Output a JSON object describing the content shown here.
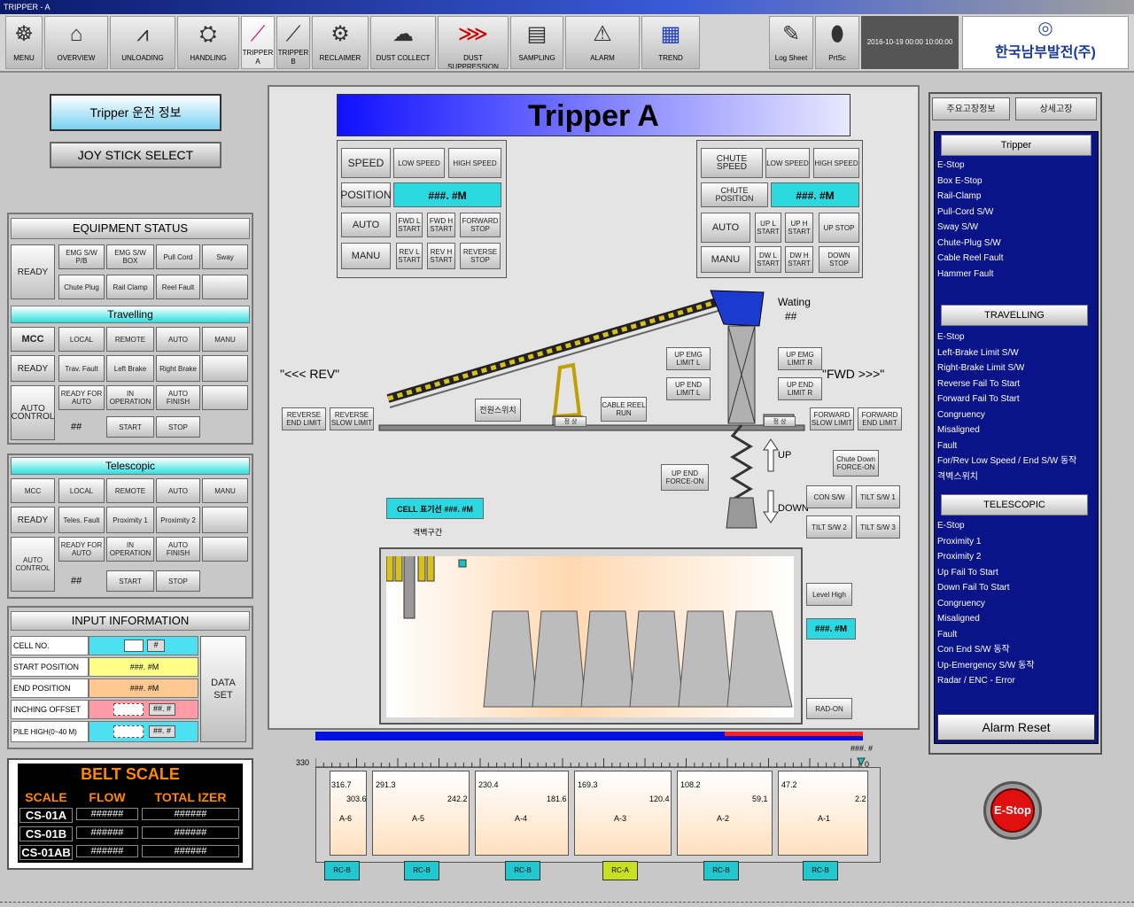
{
  "window": {
    "title": "TRIPPER - A"
  },
  "toolbar": {
    "buttons": [
      "MENU",
      "OVERVIEW",
      "UNLOADING",
      "HANDLING",
      "TRIPPER A",
      "TRIPPER B",
      "RECLAIMER",
      "DUST COLLECT",
      "DUST SUPPRESSION",
      "SAMPLING",
      "ALARM",
      "TREND",
      "Log Sheet",
      "PrtSc"
    ],
    "datetime": "2016-10-19 00:00 10:00:00",
    "logo": "한국남부발전(주)"
  },
  "left": {
    "info_btn": "Tripper 운전 정보",
    "joy_btn": "JOY STICK SELECT"
  },
  "equipment": {
    "title": "EQUIPMENT STATUS",
    "ready": "READY",
    "row1": [
      "EMG S/W P/B",
      "EMG S/W BOX",
      "Pull Cord",
      "Sway"
    ],
    "row2": [
      "Chute Plug",
      "Rail Clamp",
      "Reel Fault"
    ]
  },
  "travelling": {
    "title": "Travelling",
    "mcc": "MCC",
    "modes": [
      "LOCAL",
      "REMOTE",
      "AUTO",
      "MANU"
    ],
    "ready": "READY",
    "faults": [
      "Trav. Fault",
      "Left Brake",
      "Right Brake"
    ],
    "auto_control": "AUTO CONTROL",
    "status": [
      "READY FOR AUTO",
      "IN OPERATION",
      "AUTO FINISH"
    ],
    "hash": "##",
    "start": "START",
    "stop": "STOP"
  },
  "telescopic": {
    "title": "Telescopic",
    "mcc": "MCC",
    "modes": [
      "LOCAL",
      "REMOTE",
      "AUTO",
      "MANU"
    ],
    "ready": "READY",
    "faults": [
      "Teles. Fault",
      "Proximity 1",
      "Proximity 2"
    ],
    "auto_control": "AUTO CONTROL",
    "status": [
      "READY FOR AUTO",
      "IN OPERATION",
      "AUTO FINISH"
    ],
    "hash": "##",
    "start": "START",
    "stop": "STOP"
  },
  "input": {
    "title": "INPUT INFORMATION",
    "rows": [
      {
        "label": "CELL NO.",
        "value": "#"
      },
      {
        "label": "START POSITION",
        "value": "###. #M"
      },
      {
        "label": "END POSITION",
        "value": "###. #M"
      },
      {
        "label": "INCHING OFFSET",
        "value": "##. #"
      },
      {
        "label": "PILE HIGH(0~40 M)",
        "value": "##. #"
      }
    ],
    "data_set": "DATA SET"
  },
  "belt": {
    "title": "BELT SCALE",
    "headers": [
      "SCALE",
      "FLOW",
      "TOTAL IZER"
    ],
    "rows": [
      [
        "CS-01A",
        "######",
        "######"
      ],
      [
        "CS-01B",
        "######",
        "######"
      ],
      [
        "CS-01AB",
        "######",
        "######"
      ]
    ]
  },
  "main": {
    "title": "Tripper A",
    "speed": "SPEED",
    "low": "LOW SPEED",
    "high": "HIGH SPEED",
    "position": "POSITION",
    "pos_val": "###. #M",
    "auto": "AUTO",
    "manu": "MANU",
    "fwd": [
      "FWD L START",
      "FWD H START",
      "FORWARD STOP"
    ],
    "rev": [
      "REV L START",
      "REV H START",
      "REVERSE STOP"
    ],
    "chute_speed": "CHUTE SPEED",
    "chute_pos": "CHUTE POSITION",
    "chute_up": [
      "UP L START",
      "UP H START",
      "UP STOP"
    ],
    "chute_down": [
      "DW L START",
      "DW H START",
      "DOWN STOP"
    ],
    "rev_lbl": "\"<<< REV\"",
    "fwd_lbl": "\"FWD >>>\"",
    "waiting": "Wating",
    "waiting_val": "##",
    "rev_end": "REVERSE END LIMIT",
    "rev_slow": "REVERSE SLOW LIMIT",
    "fwd_slow": "FORWARD SLOW LIMIT",
    "fwd_end": "FORWARD END LIMIT",
    "cable": "CABLE REEL RUN",
    "panel_lbl": "전원스위치",
    "up_emg_l": "UP EMG LIMIT L",
    "up_emg_r": "UP EMG LIMIT R",
    "up_end_l": "UP END LIMIT L",
    "up_end_r": "UP END LIMIT R",
    "up": "UP",
    "down": "DOWN",
    "up_end_force": "UP END FORCE-ON",
    "chute_force": "Chute Down FORCE-ON",
    "con_sw": "CON S/W",
    "tilt": [
      "TILT S/W 1",
      "TILT S/W 2",
      "TILT S/W 3"
    ],
    "cell_label": "CELL 표기선 ###. #M",
    "range_label": "격벽구간",
    "level": "Level High",
    "level_val": "###. #M",
    "rad": "RAD-ON",
    "small_lbl": "정 상"
  },
  "scale": {
    "left": "330",
    "top": "###. #",
    "right": "0",
    "cells": [
      {
        "name": "A-6",
        "l": "316.7",
        "r": "303.6"
      },
      {
        "name": "A-5",
        "l": "291.3",
        "r": "242.2"
      },
      {
        "name": "A-4",
        "l": "230.4",
        "r": "181.6"
      },
      {
        "name": "A-3",
        "l": "169.3",
        "r": "120.4"
      },
      {
        "name": "A-2",
        "l": "108.2",
        "r": "59.1"
      },
      {
        "name": "A-1",
        "l": "47.2",
        "r": "2.2"
      }
    ],
    "feeders": [
      "RC-B",
      "RC-B",
      "RC-B",
      "RC-A",
      "RC-B",
      "RC-B"
    ]
  },
  "right": {
    "tab1": "주요고장정보",
    "tab2": "상세고장",
    "tripper_hdr": "Tripper",
    "tripper": [
      "E-Stop",
      "Box E-Stop",
      "Rail-Clamp",
      "Pull-Cord S/W",
      "Sway S/W",
      "Chute-Plug S/W",
      "Cable Reel Fault",
      "Hammer Fault"
    ],
    "trav_hdr": "TRAVELLING",
    "trav": [
      "E-Stop",
      "Left-Brake Limit S/W",
      "Right-Brake Limit S/W",
      "Reverse Fail To Start",
      "Forward Fail To Start",
      "Congruency",
      "Misaligned",
      "Fault",
      "For/Rev Low Speed / End S/W 동작",
      "격벽스위치"
    ],
    "tele_hdr": "TELESCOPIC",
    "tele": [
      "E-Stop",
      "Proximity 1",
      "Proximity 2",
      "Up Fail To Start",
      "Down Fail To Start",
      "Congruency",
      "Misaligned",
      "Fault",
      "Con End S/W 동작",
      "Up-Emergency S/W 동작",
      "Radar / ENC - Error"
    ],
    "alarm_reset": "Alarm Reset",
    "estop": "E-Stop"
  }
}
